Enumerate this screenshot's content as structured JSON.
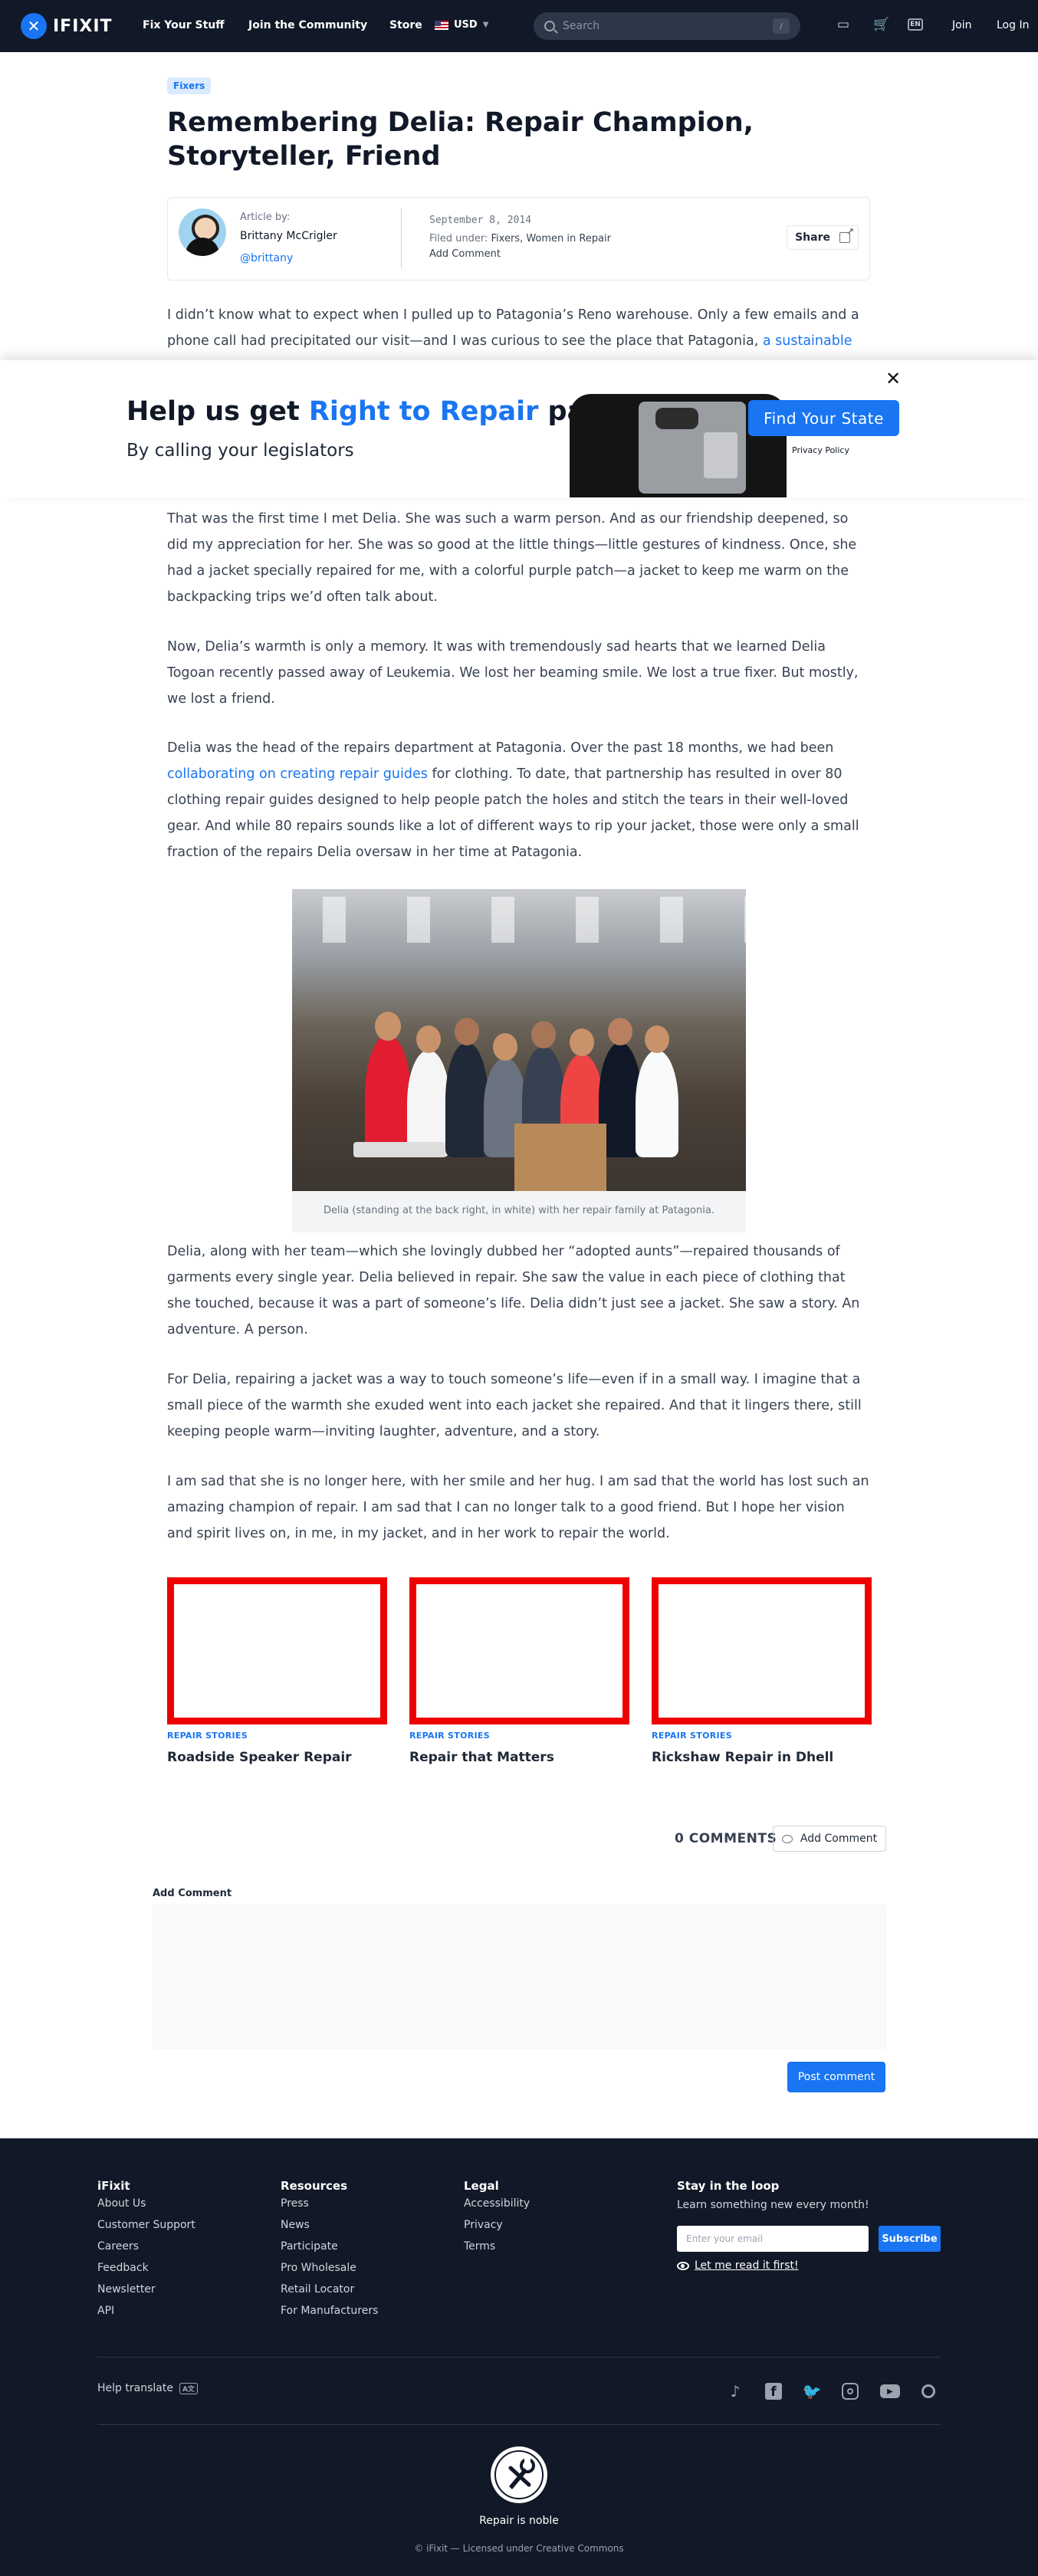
{
  "header": {
    "logo_text": "IFIXIT",
    "nav": [
      "Fix Your Stuff",
      "Join the Community",
      "Store"
    ],
    "currency": "USD",
    "search_placeholder": "Search",
    "search_shortcut": "/",
    "lang_code": "EN",
    "join": "Join",
    "login": "Log In"
  },
  "article": {
    "tag": "Fixers",
    "title": "Remembering Delia: Repair Champion, Storyteller, Friend",
    "byline": {
      "label": "Article by:",
      "author": "Brittany McCrigler",
      "handle": "@brittany",
      "date": "September 8, 2014",
      "filed_prefix": "Filed under:",
      "filed_topics": "Fixers, Women in Repair",
      "add_comment": "Add Comment",
      "share": "Share"
    },
    "intro": {
      "text": "I didn’t know what to expect when I pulled up to Patagonia’s Reno warehouse. Only a few emails and a phone call had precipitated our visit—and I was curious to see the place that Patagonia,",
      "link": "a sustainable"
    },
    "p1": "That was the first time I met Delia. She was such a warm person. And as our friendship deepened, so did my appreciation for her. She was so good at the little things—little gestures of kindness. Once, she had a jacket specially repaired for me, with a colorful purple patch—a jacket to keep me warm on the backpacking trips we’d often talk about.",
    "p2": "Now, Delia’s warmth is only a memory. It was with tremendously sad hearts that we learned Delia Togoan recently passed away of Leukemia. We lost her beaming smile. We lost a true fixer. But mostly, we lost a friend.",
    "p3": {
      "before": "Delia was the head of the repairs department at Patagonia. Over the past 18 months, we had been",
      "link": "collaborating on creating repair guides",
      "after": "for clothing. To date, that partnership has resulted in over 80 clothing repair guides designed to help people patch the holes and stitch the tears in their well-loved gear. And while 80 repairs sounds like a lot of different ways to rip your jacket, those were only a small fraction of the repairs Delia oversaw in her time at Patagonia."
    },
    "caption": "Delia (standing at the back right, in white) with her repair family at Patagonia.",
    "p4": "Delia, along with her team—which she lovingly dubbed her “adopted aunts”—repaired thousands of garments every single year. Delia believed in repair. She saw the value in each piece of clothing that she touched, because it was a part of someone’s life. Delia didn’t just see a jacket. She saw a story. An adventure. A person.",
    "p5": "For Delia, repairing a jacket was a way to touch someone’s life—even if in a small way. I imagine that a small piece of the warmth she exuded went into each jacket she repaired. And that it lingers there, still keeping people warm—inviting laughter, adventure, and a story.",
    "p6": "I am sad that she is no longer here, with her smile and her hug. I am sad that the world has lost such an amazing champion of repair. I am sad that I can no longer talk to a good friend. But I hope her vision and spirit lives on, in me, in my jacket, and in her work to repair the world."
  },
  "banner": {
    "title_a": "Help us get ",
    "title_b": "Right to Repair",
    "title_c": " passed",
    "subtitle": "By calling your legislators",
    "cta": "Find Your State",
    "privacy": "Privacy Policy"
  },
  "related": [
    {
      "category": "REPAIR STORIES",
      "title": "Roadside Speaker Repair"
    },
    {
      "category": "REPAIR STORIES",
      "title": "Repair that Matters"
    },
    {
      "category": "REPAIR STORIES",
      "title": "Rickshaw Repair in Dhell"
    }
  ],
  "comments": {
    "count_label": "0 COMMENTS",
    "add_button": "Add Comment",
    "form_label": "Add Comment",
    "post": "Post comment"
  },
  "footer": {
    "columns": [
      {
        "heading": "iFixit",
        "links": [
          "About Us",
          "Customer Support",
          "Careers",
          "Feedback",
          "Newsletter",
          "API"
        ]
      },
      {
        "heading": "Resources",
        "links": [
          "Press",
          "News",
          "Participate",
          "Pro Wholesale",
          "Retail Locator",
          "For Manufacturers"
        ]
      },
      {
        "heading": "Legal",
        "links": [
          "Accessibility",
          "Privacy",
          "Terms"
        ]
      }
    ],
    "newsletter": {
      "heading": "Stay in the loop",
      "sub": "Learn something new every month!",
      "placeholder": "Enter your email",
      "button": "Subscribe",
      "read_first": "Let me read it first!"
    },
    "help_translate": "Help translate",
    "translate_badge": "A文",
    "tagline": "Repair is noble",
    "license": "© iFixit — Licensed under Creative Commons"
  }
}
